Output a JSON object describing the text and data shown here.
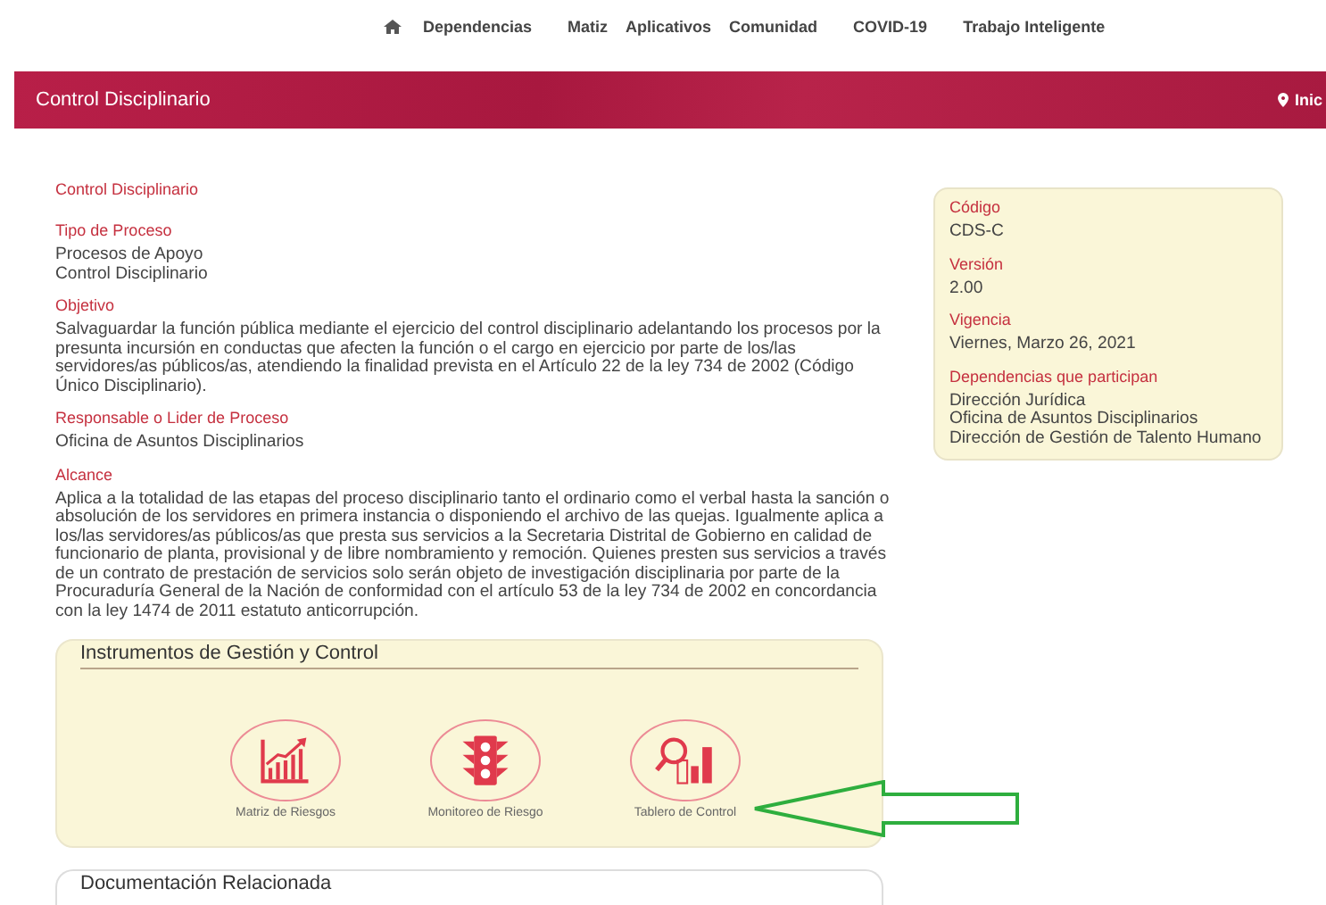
{
  "nav": {
    "items": [
      {
        "label": "Dependencias"
      },
      {
        "label": "Matiz"
      },
      {
        "label": "Aplicativos"
      },
      {
        "label": "Comunidad"
      },
      {
        "label": "COVID-19"
      },
      {
        "label": "Trabajo Inteligente"
      }
    ]
  },
  "banner": {
    "title": "Control Disciplinario",
    "breadcrumb": "Inic"
  },
  "main": {
    "title": "Control Disciplinario",
    "sections": [
      {
        "heading": "Tipo de Proceso",
        "lines": [
          "Procesos de Apoyo",
          "Control Disciplinario"
        ]
      },
      {
        "heading": "Objetivo",
        "lines": [
          "Salvaguardar la función pública mediante el ejercicio del control disciplinario adelantando los procesos por la presunta incursión en conductas que afecten la función o el cargo en ejercicio por parte de los/las servidores/as públicos/as, atendiendo la finalidad prevista en el Artículo 22 de la ley 734 de 2002 (Código Único Disciplinario)."
        ]
      },
      {
        "heading": "Responsable o Lider de Proceso",
        "lines": [
          "Oficina de Asuntos Disciplinarios"
        ]
      },
      {
        "heading": "Alcance",
        "lines": [
          "Aplica a la totalidad de las etapas del proceso disciplinario tanto el ordinario como el verbal hasta la sanción o absolución de los servidores en primera instancia o disponiendo el archivo de las quejas. Igualmente aplica a los/las servidores/as públicos/as que presta sus servicios a la Secretaria Distrital de Gobierno en calidad de funcionario de planta, provisional y de libre nombramiento y remoción. Quienes presten sus servicios a través de un contrato de prestación de servicios solo serán objeto de investigación disciplinaria por parte de la Procuraduría General de la Nación de conformidad con el artículo 53 de la ley 734 de 2002 en concordancia con la ley 1474 de 2011 estatuto anticorrupción."
        ]
      }
    ]
  },
  "info_card": {
    "fields": [
      {
        "heading": "Código",
        "lines": [
          "CDS-C"
        ]
      },
      {
        "heading": "Versión",
        "lines": [
          "2.00"
        ]
      },
      {
        "heading": "Vigencia",
        "lines": [
          "Viernes, Marzo 26, 2021"
        ]
      },
      {
        "heading": "Dependencias que participan",
        "lines": [
          "Dirección Jurídica",
          "Oficina de Asuntos Disciplinarios",
          "Dirección de Gestión de Talento Humano"
        ]
      }
    ]
  },
  "instruments": {
    "title": "Instrumentos de Gestión y Control",
    "items": [
      {
        "kind": "chart",
        "label": "Matriz de Riesgos"
      },
      {
        "kind": "traffic",
        "label": "Monitoreo de Riesgo"
      },
      {
        "kind": "dashboard",
        "label": "Tablero de Control"
      }
    ]
  },
  "documents": {
    "title": "Documentación Relacionada"
  }
}
